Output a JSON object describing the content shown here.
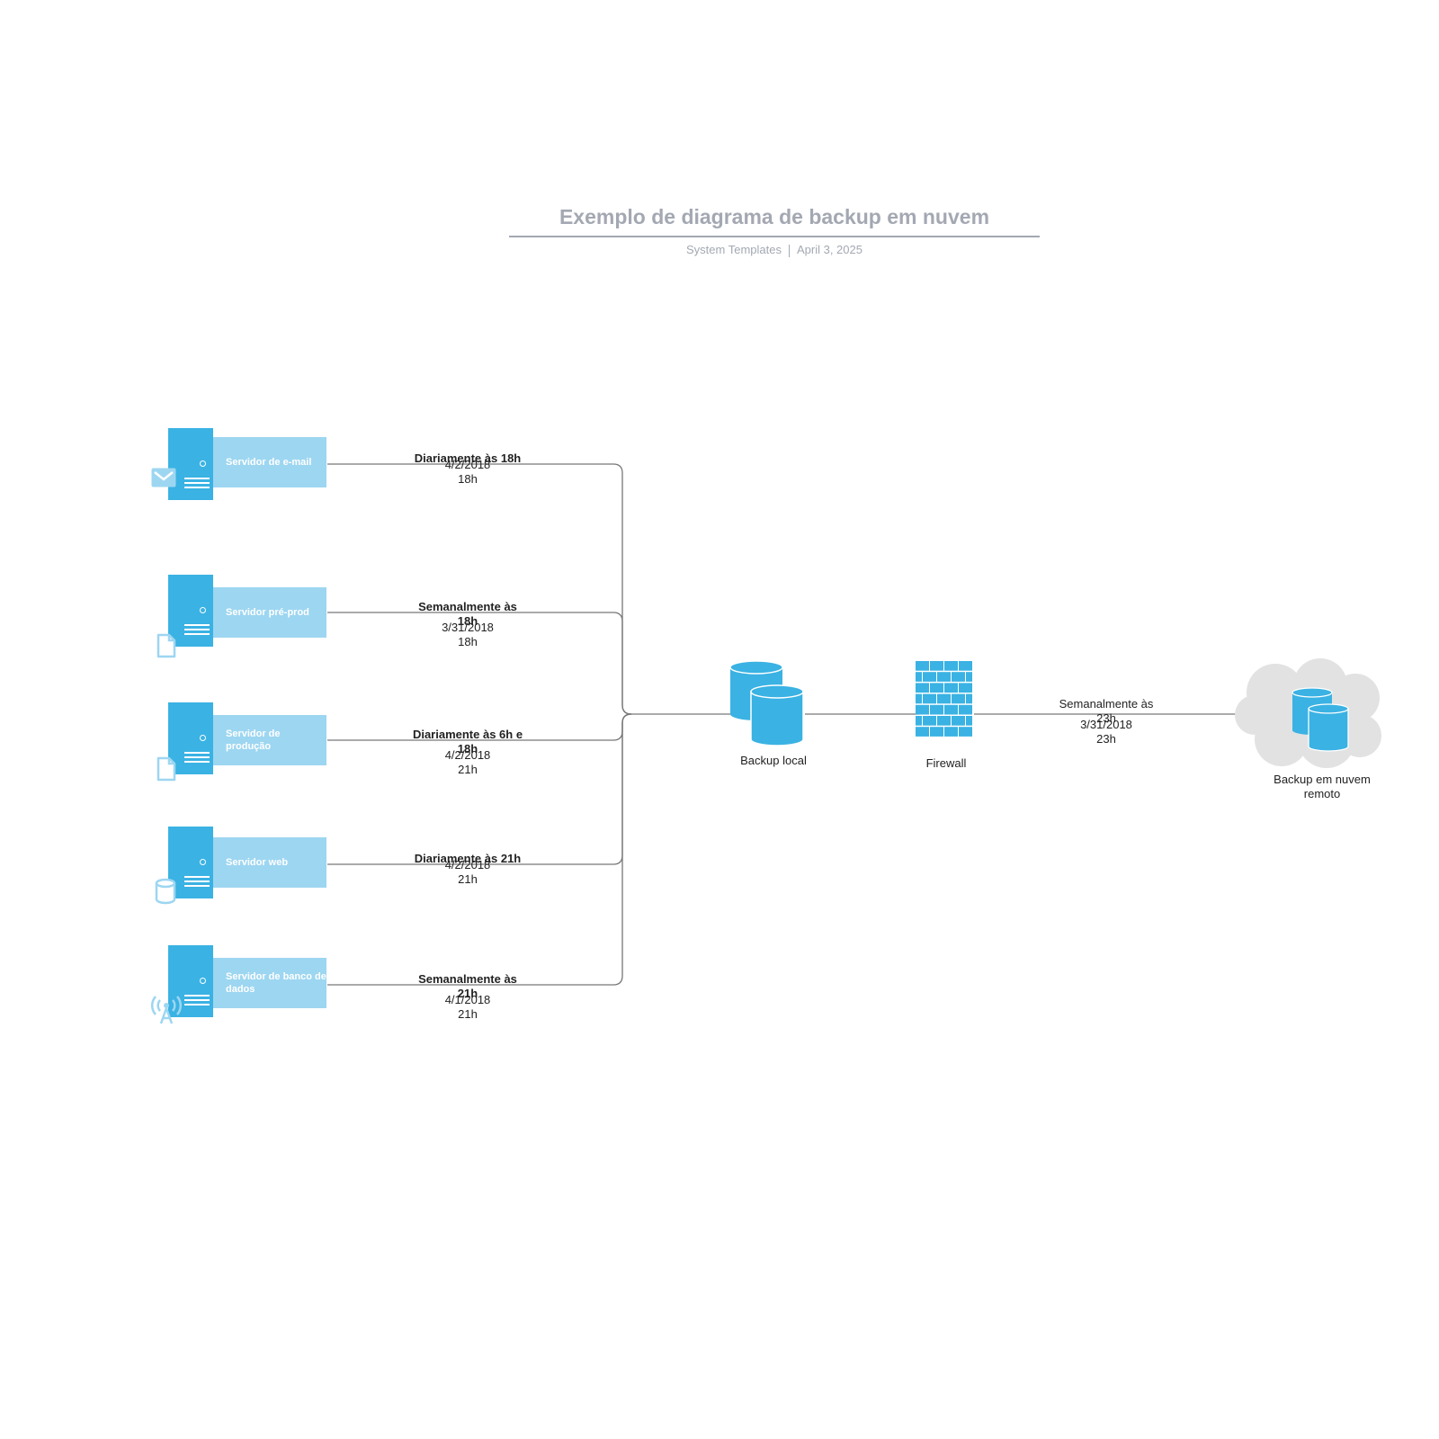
{
  "header": {
    "title": "Exemplo de diagrama de backup em nuvem",
    "author": "System Templates",
    "date": "April 3, 2025"
  },
  "colors": {
    "server_dark": "#3ab2e3",
    "server_light": "#9dd6f1",
    "cloud": "#e2e2e2",
    "title_gray": "#a3a8b2",
    "wire": "#777777"
  },
  "servers": [
    {
      "label": "Servidor de e-mail",
      "badge_icon": "envelope-icon",
      "schedule": "Diariamente às 18h",
      "date": "4/2/2018",
      "time": "18h"
    },
    {
      "label": "Servidor pré-prod",
      "badge_icon": "document-icon",
      "schedule": "Semanalmente às 18h",
      "date": "3/31/2018",
      "time": "18h"
    },
    {
      "label": "Servidor de produção",
      "badge_icon": "document-icon",
      "schedule": "Diariamente às 6h e 18h",
      "date": "4/2/2018",
      "time": "21h"
    },
    {
      "label": "Servidor web",
      "badge_icon": "database-icon",
      "schedule": "Diariamente às 21h",
      "date": "4/2/2018",
      "time": "21h"
    },
    {
      "label": "Servidor de banco de dados",
      "badge_icon": "antenna-icon",
      "schedule": "Semanalmente às 21h",
      "date": "4/1/2018",
      "time": "21h"
    }
  ],
  "nodes": {
    "local_backup": {
      "label": "Backup local"
    },
    "firewall": {
      "label": "Firewall"
    },
    "cloud_backup": {
      "label": "Backup em nuvem remoto"
    }
  },
  "cloud_link": {
    "schedule": "Semanalmente às 23h",
    "date": "3/31/2018",
    "time": "23h"
  }
}
